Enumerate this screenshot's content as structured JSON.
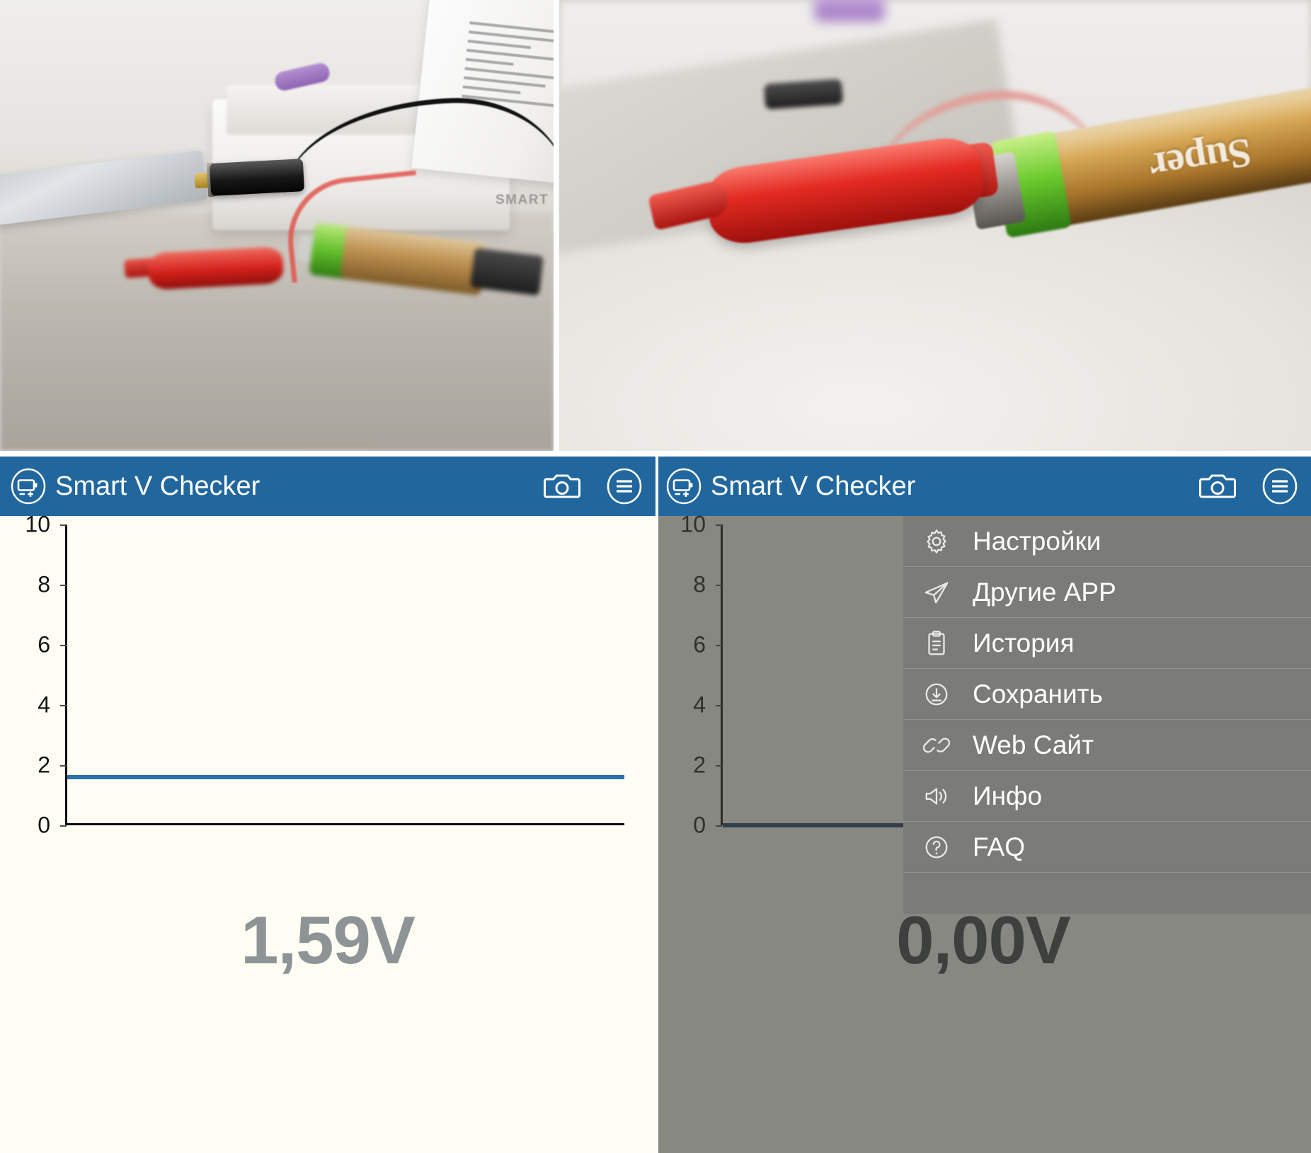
{
  "app": {
    "title": "Smart V Checker",
    "brand_color": "#21679e",
    "logo_icon": "battery-checker-icon",
    "camera_icon": "camera-icon",
    "menu_icon": "hamburger-circle-icon"
  },
  "panels": {
    "left": {
      "voltage_reading": "1,59V",
      "background_color": "#fdfdf3",
      "line_color": "#2f6fad",
      "dimmed": false
    },
    "right": {
      "voltage_reading": "0,00V",
      "background_color": "#6e6e69",
      "line_color": "#1d3c5e",
      "dimmed": true
    }
  },
  "drawer": {
    "background_color": "#7b7b77",
    "items": [
      {
        "label": "Настройки",
        "icon": "gear-icon"
      },
      {
        "label": "Другие APP",
        "icon": "paper-plane-icon"
      },
      {
        "label": "История",
        "icon": "clipboard-icon"
      },
      {
        "label": "Сохранить",
        "icon": "download-circle-icon"
      },
      {
        "label": "Web Сайт",
        "icon": "link-icon"
      },
      {
        "label": "Инфо",
        "icon": "speaker-icon"
      },
      {
        "label": "FAQ",
        "icon": "question-circle-icon"
      }
    ]
  },
  "photos": {
    "left": {
      "caption_text_on_box": "SMART",
      "spec_lines": 9
    },
    "right": {
      "battery_label": "Super"
    }
  },
  "chart_data": [
    {
      "type": "line",
      "title": "",
      "panel": "left",
      "xlabel": "",
      "ylabel": "",
      "ylim": [
        0,
        10
      ],
      "yticks": [
        0,
        2,
        4,
        6,
        8,
        10
      ],
      "ytick_labels": [
        "0",
        "2",
        "4",
        "6",
        "8",
        "10"
      ],
      "grid": false,
      "legend": "none",
      "series": [
        {
          "name": "voltage",
          "constant_value": 1.59,
          "color": "#2f6fad"
        }
      ]
    },
    {
      "type": "line",
      "title": "",
      "panel": "right",
      "xlabel": "",
      "ylabel": "",
      "ylim": [
        0,
        10
      ],
      "yticks": [
        0,
        2,
        4,
        6,
        8,
        10
      ],
      "ytick_labels": [
        "0",
        "2",
        "4",
        "6",
        "8",
        "10"
      ],
      "grid": false,
      "legend": "none",
      "series": [
        {
          "name": "voltage",
          "constant_value": 0.0,
          "color": "#1d3c5e"
        }
      ]
    }
  ]
}
